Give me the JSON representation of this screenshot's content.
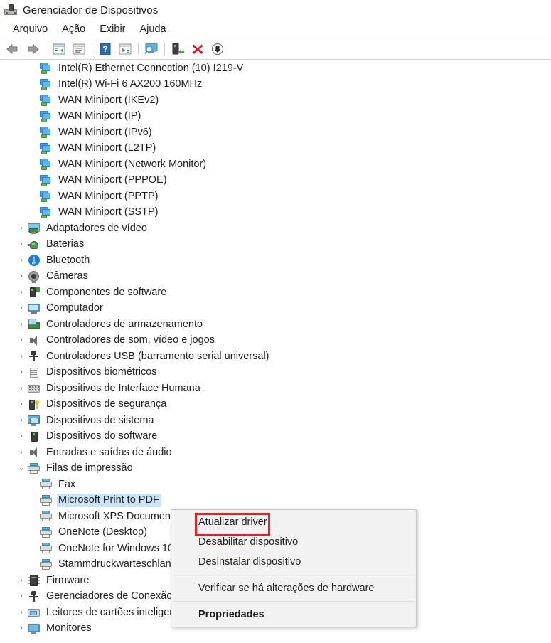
{
  "window": {
    "title": "Gerenciador de Dispositivos",
    "icon": "device-manager-icon"
  },
  "menubar": {
    "items": [
      {
        "label": "Arquivo",
        "name": "menu-arquivo"
      },
      {
        "label": "Ação",
        "name": "menu-acao"
      },
      {
        "label": "Exibir",
        "name": "menu-exibir"
      },
      {
        "label": "Ajuda",
        "name": "menu-ajuda"
      }
    ]
  },
  "toolbar": {
    "buttons": [
      {
        "name": "back-button",
        "icon": "back-arrow-icon"
      },
      {
        "name": "forward-button",
        "icon": "forward-arrow-icon"
      },
      {
        "name": "separator-1",
        "icon": "separator"
      },
      {
        "name": "show-hide-console-tree-button",
        "icon": "console-tree-icon"
      },
      {
        "name": "properties-button",
        "icon": "properties-window-icon"
      },
      {
        "name": "separator-2",
        "icon": "separator"
      },
      {
        "name": "help-button",
        "icon": "help-question-icon"
      },
      {
        "name": "show-hidden-devices-button",
        "icon": "play-window-icon"
      },
      {
        "name": "separator-3",
        "icon": "separator"
      },
      {
        "name": "scan-hardware-changes-button",
        "icon": "monitor-magnifier-icon"
      },
      {
        "name": "separator-4",
        "icon": "separator"
      },
      {
        "name": "update-driver-button",
        "icon": "device-update-icon"
      },
      {
        "name": "uninstall-device-button",
        "icon": "red-x-icon"
      },
      {
        "name": "disable-device-button",
        "icon": "down-arrow-circle-icon"
      }
    ]
  },
  "tree": {
    "rows": [
      {
        "label": "Intel(R) Ethernet Connection (10) I219-V",
        "level": 2,
        "icon": "network-adapter-icon",
        "twisty": "",
        "selected": false
      },
      {
        "label": "Intel(R) Wi-Fi 6 AX200 160MHz",
        "level": 2,
        "icon": "network-adapter-icon",
        "twisty": "",
        "selected": false
      },
      {
        "label": "WAN Miniport (IKEv2)",
        "level": 2,
        "icon": "network-adapter-icon",
        "twisty": "",
        "selected": false
      },
      {
        "label": "WAN Miniport (IP)",
        "level": 2,
        "icon": "network-adapter-icon",
        "twisty": "",
        "selected": false
      },
      {
        "label": "WAN Miniport (IPv6)",
        "level": 2,
        "icon": "network-adapter-icon",
        "twisty": "",
        "selected": false
      },
      {
        "label": "WAN Miniport (L2TP)",
        "level": 2,
        "icon": "network-adapter-icon",
        "twisty": "",
        "selected": false
      },
      {
        "label": "WAN Miniport (Network Monitor)",
        "level": 2,
        "icon": "network-adapter-icon",
        "twisty": "",
        "selected": false
      },
      {
        "label": "WAN Miniport (PPPOE)",
        "level": 2,
        "icon": "network-adapter-icon",
        "twisty": "",
        "selected": false
      },
      {
        "label": "WAN Miniport (PPTP)",
        "level": 2,
        "icon": "network-adapter-icon",
        "twisty": "",
        "selected": false
      },
      {
        "label": "WAN Miniport (SSTP)",
        "level": 2,
        "icon": "network-adapter-icon",
        "twisty": "",
        "selected": false
      },
      {
        "label": "Adaptadores de vídeo",
        "level": 1,
        "icon": "video-adapter-icon",
        "twisty": "›",
        "selected": false
      },
      {
        "label": "Baterias",
        "level": 1,
        "icon": "battery-icon",
        "twisty": "›",
        "selected": false
      },
      {
        "label": "Bluetooth",
        "level": 1,
        "icon": "bluetooth-icon",
        "twisty": "›",
        "selected": false
      },
      {
        "label": "Câmeras",
        "level": 1,
        "icon": "camera-icon",
        "twisty": "›",
        "selected": false
      },
      {
        "label": "Componentes de software",
        "level": 1,
        "icon": "software-component-icon",
        "twisty": "›",
        "selected": false
      },
      {
        "label": "Computador",
        "level": 1,
        "icon": "computer-icon",
        "twisty": "›",
        "selected": false
      },
      {
        "label": "Controladores de armazenamento",
        "level": 1,
        "icon": "storage-controller-icon",
        "twisty": "›",
        "selected": false
      },
      {
        "label": "Controladores de som, vídeo e jogos",
        "level": 1,
        "icon": "sound-controller-icon",
        "twisty": "›",
        "selected": false
      },
      {
        "label": "Controladores USB (barramento serial universal)",
        "level": 1,
        "icon": "usb-controller-icon",
        "twisty": "›",
        "selected": false
      },
      {
        "label": "Dispositivos biométricos",
        "level": 1,
        "icon": "biometric-device-icon",
        "twisty": "›",
        "selected": false
      },
      {
        "label": "Dispositivos de Interface Humana",
        "level": 1,
        "icon": "hid-device-icon",
        "twisty": "›",
        "selected": false
      },
      {
        "label": "Dispositivos de segurança",
        "level": 1,
        "icon": "security-device-icon",
        "twisty": "›",
        "selected": false
      },
      {
        "label": "Dispositivos de sistema",
        "level": 1,
        "icon": "system-device-icon",
        "twisty": "›",
        "selected": false
      },
      {
        "label": "Dispositivos do software",
        "level": 1,
        "icon": "software-device-icon",
        "twisty": "›",
        "selected": false
      },
      {
        "label": "Entradas e saídas de áudio",
        "level": 1,
        "icon": "audio-io-icon",
        "twisty": "›",
        "selected": false
      },
      {
        "label": "Filas de impressão",
        "level": 1,
        "icon": "print-queue-icon",
        "twisty": "⌄",
        "selected": false
      },
      {
        "label": "Fax",
        "level": 2,
        "icon": "printer-icon",
        "twisty": "",
        "selected": false
      },
      {
        "label": "Microsoft Print to PDF",
        "level": 2,
        "icon": "printer-icon",
        "twisty": "",
        "selected": true
      },
      {
        "label": "Microsoft XPS Document Writer",
        "level": 2,
        "icon": "printer-icon",
        "twisty": "",
        "selected": false
      },
      {
        "label": "OneNote (Desktop)",
        "level": 2,
        "icon": "printer-icon",
        "twisty": "",
        "selected": false
      },
      {
        "label": "OneNote for Windows 10",
        "level": 2,
        "icon": "printer-icon",
        "twisty": "",
        "selected": false
      },
      {
        "label": "Stammdruckwarteschlange",
        "level": 2,
        "icon": "printer-icon",
        "twisty": "",
        "selected": false
      },
      {
        "label": "Firmware",
        "level": 1,
        "icon": "firmware-icon",
        "twisty": "›",
        "selected": false
      },
      {
        "label": "Gerenciadores de Conexão",
        "level": 1,
        "icon": "usb-controller-icon",
        "twisty": "›",
        "selected": false
      },
      {
        "label": "Leitores de cartões inteligentes",
        "level": 1,
        "icon": "smart-card-reader-icon",
        "twisty": "›",
        "selected": false
      },
      {
        "label": "Monitores",
        "level": 1,
        "icon": "monitor-icon",
        "twisty": "›",
        "selected": false
      }
    ]
  },
  "context_menu": {
    "items": [
      {
        "label": "Atualizar driver",
        "name": "ctx-update-driver",
        "type": "item",
        "bold": false,
        "highlighted": true
      },
      {
        "label": "Desabilitar dispositivo",
        "name": "ctx-disable-device",
        "type": "item",
        "bold": false,
        "highlighted": false
      },
      {
        "label": "Desinstalar dispositivo",
        "name": "ctx-uninstall-device",
        "type": "item",
        "bold": false,
        "highlighted": false
      },
      {
        "type": "separator",
        "name": "ctx-separator-1"
      },
      {
        "label": "Verificar se há alterações de hardware",
        "name": "ctx-scan-hardware-changes",
        "type": "item",
        "bold": false,
        "highlighted": false
      },
      {
        "type": "separator",
        "name": "ctx-separator-2"
      },
      {
        "label": "Propriedades",
        "name": "ctx-properties",
        "type": "item",
        "bold": true,
        "highlighted": false
      }
    ]
  },
  "colors": {
    "selection": "#cce4f7",
    "highlight_box": "#e02020",
    "menu_background": "#f2f2f2",
    "text": "#1d1d1d"
  }
}
